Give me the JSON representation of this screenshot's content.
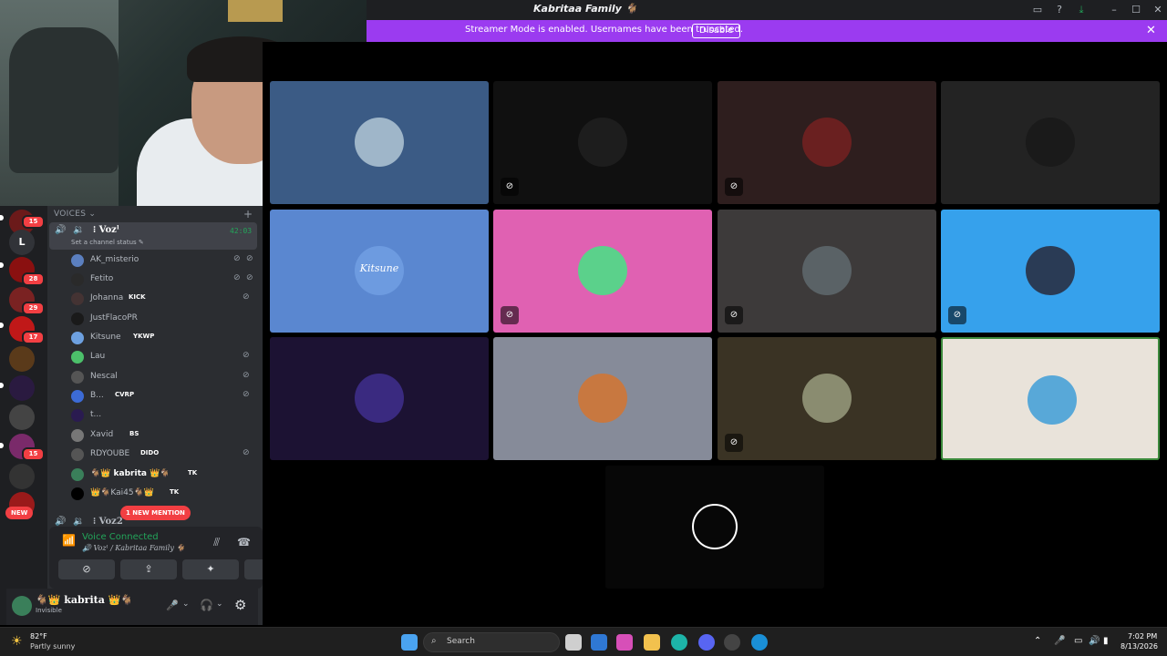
{
  "window": {
    "title": "Kabritaa Family 🐐",
    "controls": {
      "minimize": "–",
      "maximize": "☐",
      "close": "✕"
    }
  },
  "banner": {
    "text": "Streamer Mode is enabled. Usernames have been truncated.",
    "disable_label": "Disable",
    "close": "✕"
  },
  "rail": {
    "home_letter": "L",
    "badges": [
      "15",
      "28",
      "29",
      "17",
      "15"
    ],
    "new_label": "NEW"
  },
  "channels": {
    "section_label": "VOICES ⌄",
    "add": "+",
    "active_channel": {
      "name": "⁝ Vozˡ",
      "status": "Set a channel status ✎",
      "timer": "42:03"
    },
    "members": [
      {
        "name": "AK_misterio",
        "tag": "",
        "color": "#5b7fbf"
      },
      {
        "name": "Fetito",
        "tag": "",
        "color": "#2a2a2a"
      },
      {
        "name": "Johanna",
        "tag": "KICK",
        "color": "#443333"
      },
      {
        "name": "JustFlacoPR",
        "tag": "",
        "color": "#1a1a1a"
      },
      {
        "name": "Kitsune",
        "tag": "YKWP",
        "color": "#6da0e0"
      },
      {
        "name": "Lau",
        "tag": "",
        "color": "#4cc06a"
      },
      {
        "name": "Nescal",
        "tag": "",
        "color": "#555"
      },
      {
        "name": "B...",
        "tag": "CVRP",
        "color": "#3c6bd6"
      },
      {
        "name": "t...",
        "tag": "",
        "color": "#2a1b50"
      },
      {
        "name": "Xavid",
        "tag": "BS",
        "color": "#777"
      },
      {
        "name": "RDYOUBE",
        "tag": "DIDO",
        "color": "#555"
      },
      {
        "name": "🐐👑 kabrita 👑🐐",
        "tag": "TK",
        "color": "#3a7f5a"
      },
      {
        "name": "👑🐐Kai45🐐👑",
        "tag": "TK",
        "color": "#000"
      }
    ],
    "second_channel": "⁝ Voz2",
    "mention_pill": "1 NEW MENTION"
  },
  "voice_panel": {
    "title": "Voice Connected",
    "subtitle": "🔊 Vozˡ / Kabritaa Family 🐐",
    "buttons": [
      "⊘",
      "⇪",
      "✦",
      "✺"
    ]
  },
  "user_panel": {
    "name": "🐐👑 kabrita 👑🐐",
    "status": "Invisible"
  },
  "tiles": [
    {
      "bg": "#3b5b85",
      "avatar": "#9fb6c9",
      "muted": false
    },
    {
      "bg": "#101010",
      "avatar": "#1d1d1d",
      "muted": true
    },
    {
      "bg": "#2e1e1e",
      "avatar": "#6a2020",
      "muted": false
    },
    {
      "bg": "#232323",
      "avatar": "#1a1a1a",
      "muted": false
    },
    {
      "bg": "#5a87d0",
      "avatar": "#6d9be0",
      "muted": false,
      "label": "Kitsune"
    },
    {
      "bg": "#e061b2",
      "avatar": "#5bd18b",
      "muted": true
    },
    {
      "bg": "#3d3a3a",
      "avatar": "#5a6266",
      "muted": true
    },
    {
      "bg": "#36a1ec",
      "avatar": "#2a3b55",
      "muted": true
    },
    {
      "bg": "#1c1233",
      "avatar": "#3a2a80",
      "muted": false
    },
    {
      "bg": "#868b99",
      "avatar": "#c87840",
      "muted": false
    },
    {
      "bg": "#3a3324",
      "avatar": "#8a8c70",
      "muted": true
    },
    {
      "bg": "#e9e3da",
      "avatar": "#58a8d8",
      "muted": false,
      "speaking": true
    },
    {
      "bg": "#070707",
      "avatar": "#000",
      "muted": false,
      "spinner": true
    }
  ],
  "taskbar": {
    "weather_temp": "82°F",
    "weather_desc": "Partly sunny",
    "search_label": "Search",
    "time": "7:02 PM",
    "date": "8/13/2026"
  }
}
